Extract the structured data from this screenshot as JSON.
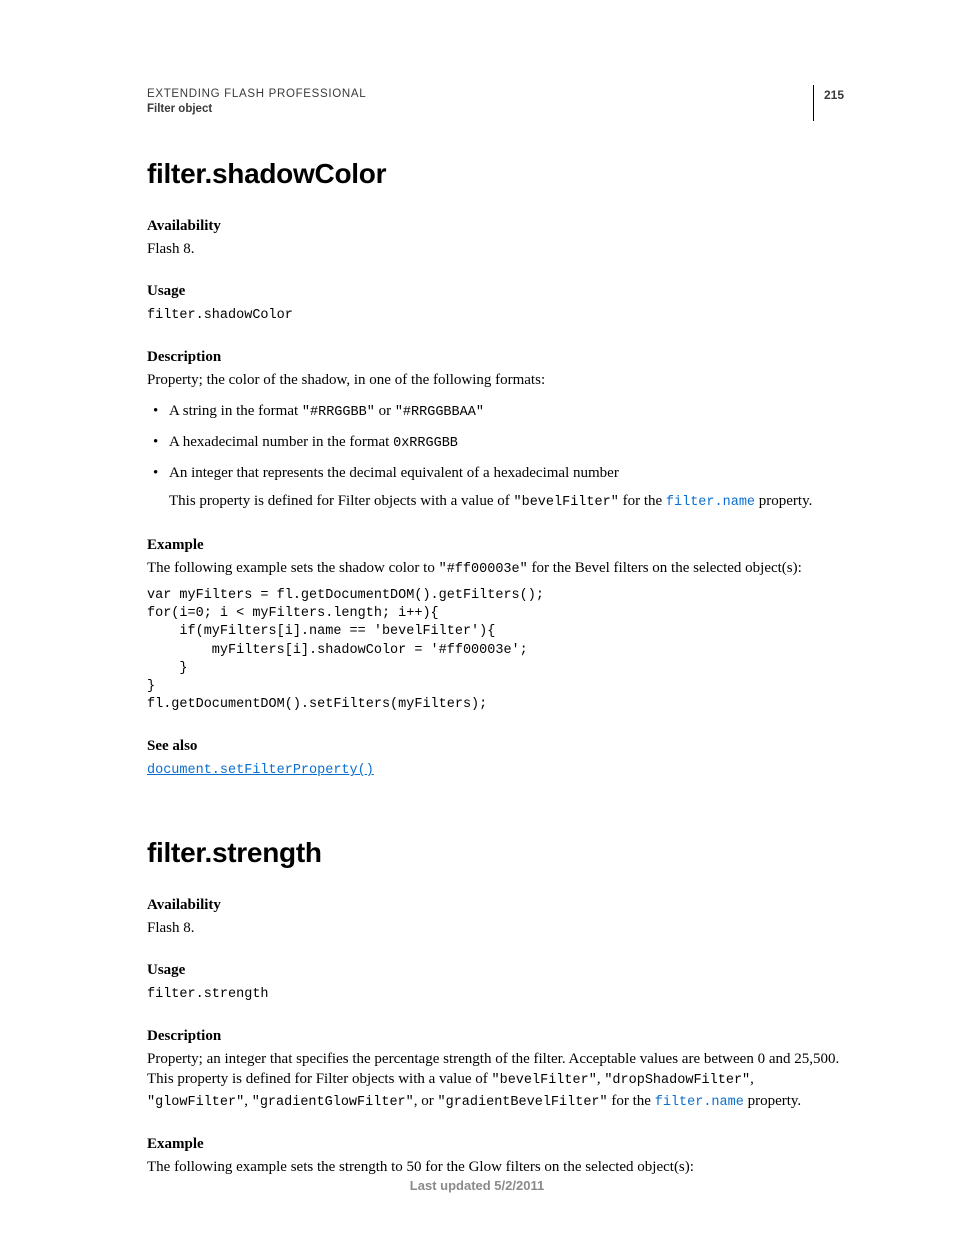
{
  "running_head": {
    "line1": "EXTENDING FLASH PROFESSIONAL",
    "line2": "Filter object",
    "page_number": "215"
  },
  "section1": {
    "title": "filter.shadowColor",
    "h_availability": "Availability",
    "availability_text": "Flash 8.",
    "h_usage": "Usage",
    "usage_code": "filter.shadowColor",
    "h_description": "Description",
    "description_text": "Property; the color of the shadow, in one of the following formats:",
    "bullets": {
      "b1_pre": "A string in the format ",
      "b1_code1": "\"#RRGGBB\"",
      "b1_or": " or ",
      "b1_code2": "\"#RRGGBBAA\"",
      "b2_pre": "A hexadecimal number in the format ",
      "b2_code": "0xRRGGBB",
      "b3_text": "An integer that represents the decimal equivalent of a hexadecimal number",
      "b3_sub_pre": "This property is defined for Filter objects with a value of ",
      "b3_sub_code": "\"bevelFilter\"",
      "b3_sub_for": " for the ",
      "b3_sub_link": "filter.name",
      "b3_sub_post": " property."
    },
    "h_example": "Example",
    "example_intro_pre": "The following example sets the shadow color to ",
    "example_intro_code": "\"#ff00003e\"",
    "example_intro_post": " for the Bevel filters on the selected object(s):",
    "example_code": "var myFilters = fl.getDocumentDOM().getFilters();\nfor(i=0; i < myFilters.length; i++){\n    if(myFilters[i].name == 'bevelFilter'){\n        myFilters[i].shadowColor = '#ff00003e';\n    }\n}\nfl.getDocumentDOM().setFilters(myFilters);",
    "h_seealso": "See also",
    "seealso_link": "document.setFilterProperty()"
  },
  "section2": {
    "title": "filter.strength",
    "h_availability": "Availability",
    "availability_text": "Flash 8.",
    "h_usage": "Usage",
    "usage_code": "filter.strength",
    "h_description": "Description",
    "desc_pre": "Property; an integer that specifies the percentage strength of the filter. Acceptable values are between 0 and 25,500. This property is defined for Filter objects with a value of ",
    "desc_c1": "\"bevelFilter\"",
    "desc_s1": ", ",
    "desc_c2": "\"dropShadowFilter\"",
    "desc_s2": ", ",
    "desc_c3": "\"glowFilter\"",
    "desc_s3": ", ",
    "desc_c4": "\"gradientGlowFilter\"",
    "desc_s4": ", or ",
    "desc_c5": "\"gradientBevelFilter\"",
    "desc_for": " for the ",
    "desc_link": "filter.name",
    "desc_post": " property.",
    "h_example": "Example",
    "example_intro": "The following example sets the strength to 50 for the Glow filters on the selected object(s):"
  },
  "footer": {
    "text": "Last updated 5/2/2011"
  }
}
